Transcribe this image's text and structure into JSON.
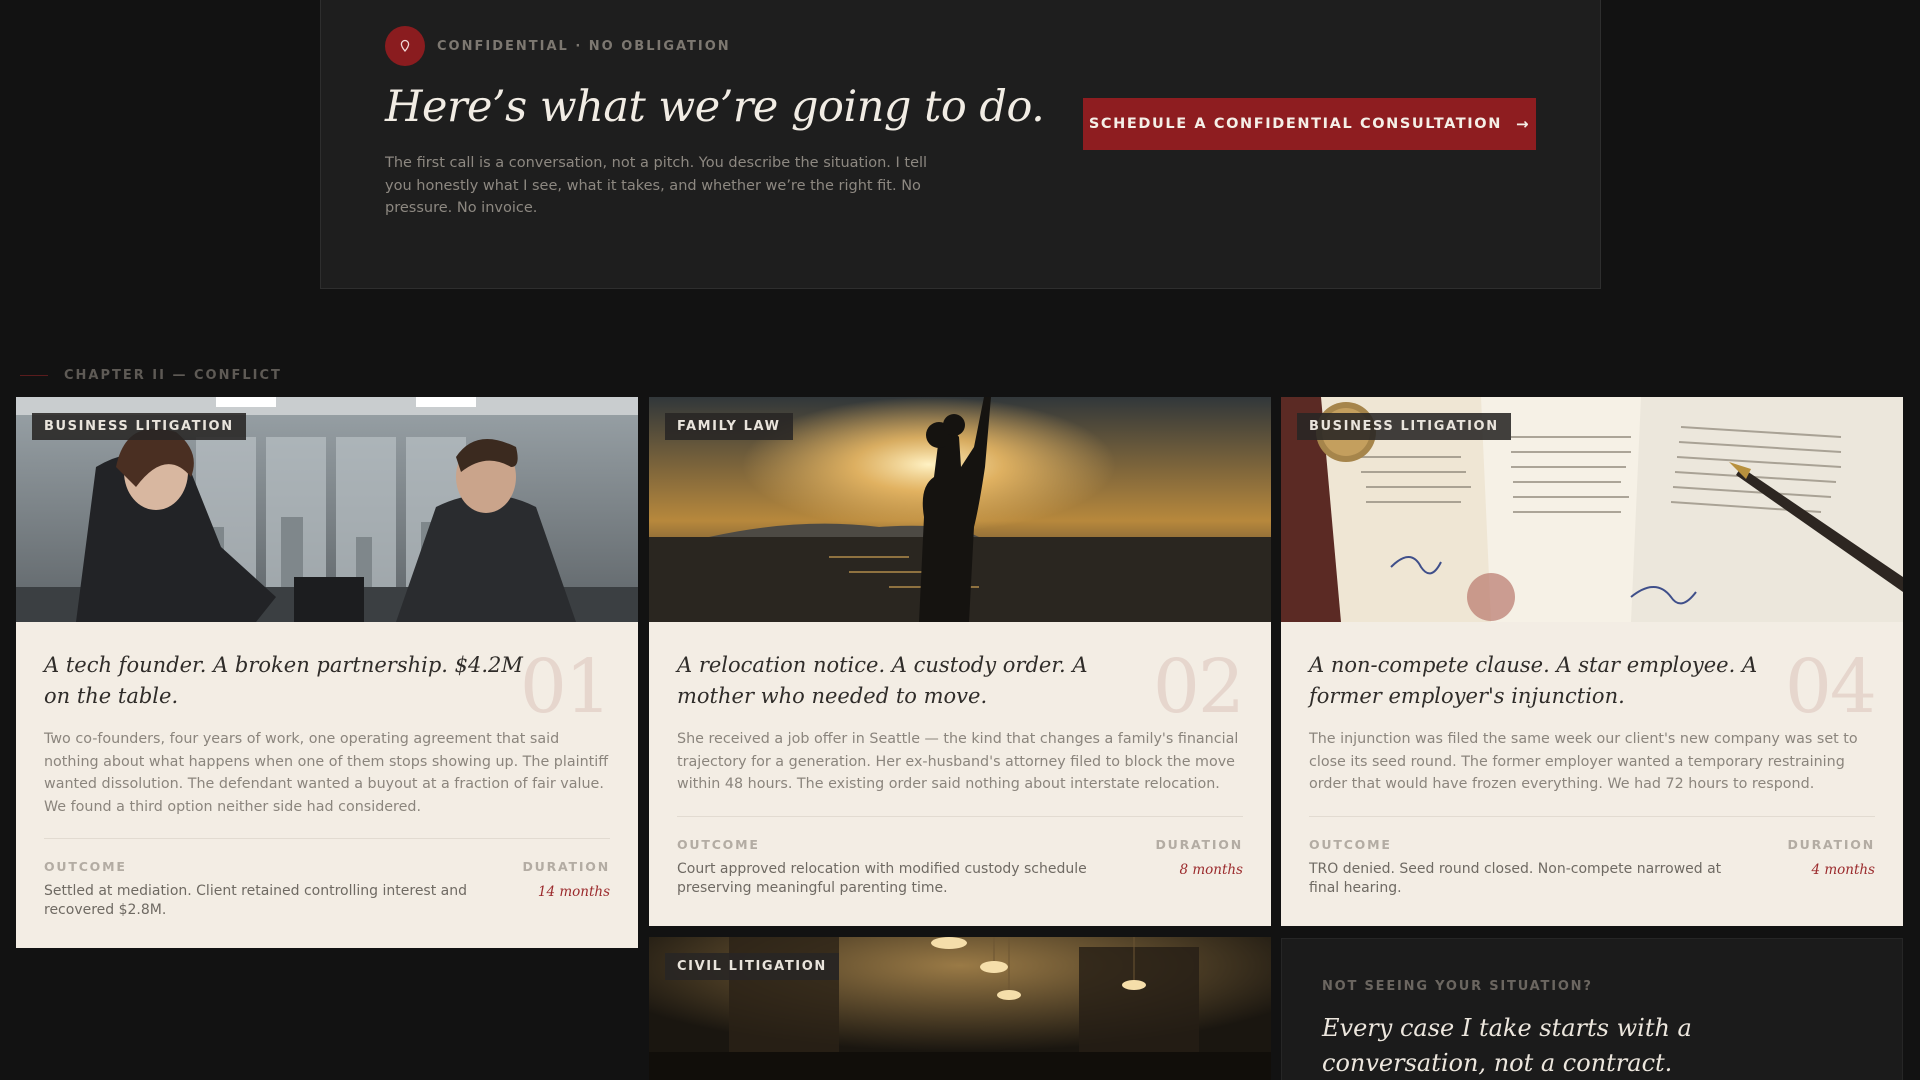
{
  "cta": {
    "badge_icon": "location-pin-icon",
    "badge_label": "CONFIDENTIAL · NO OBLIGATION",
    "heading": "Here’s what we’re going to do.",
    "body": "The first call is a conversation, not a pitch. You describe the situation. I tell you honestly what I see, what it takes, and whether we’re the right fit. No pressure. No invoice.",
    "button_label": "SCHEDULE A CONFIDENTIAL CONSULTATION",
    "button_arrow": "→",
    "accent_color": "#8e1d20"
  },
  "chapter": {
    "label": "CHAPTER II — CONFLICT"
  },
  "cases": [
    {
      "tag": "BUSINESS LITIGATION",
      "number": "01",
      "title": "A tech founder. A broken partnership. $4.2M on the table.",
      "description": "Two co-founders, four years of work, one operating agreement that said nothing about what happens when one of them stops showing up. The plaintiff wanted dissolution. The defendant wanted a buyout at a fraction of fair value. We found a third option neither side had considered.",
      "outcome_label": "OUTCOME",
      "outcome": "Settled at mediation. Client retained controlling interest and recovered $2.8M.",
      "duration_label": "DURATION",
      "duration": "14 months"
    },
    {
      "tag": "FAMILY LAW",
      "number": "02",
      "title": "A relocation notice. A custody order. A mother who needed to move.",
      "description": "She received a job offer in Seattle — the kind that changes a family's financial trajectory for a generation. Her ex-husband's attorney filed to block the move within 48 hours. The existing order said nothing about interstate relocation.",
      "outcome_label": "OUTCOME",
      "outcome": "Court approved relocation with modified custody schedule preserving meaningful parenting time.",
      "duration_label": "DURATION",
      "duration": "8 months"
    },
    {
      "tag": "BUSINESS LITIGATION",
      "number": "04",
      "title": "A non-compete clause. A star employee. A former employer's injunction.",
      "description": "The injunction was filed the same week our client's new company was set to close its seed round. The former employer wanted a temporary restraining order that would have frozen everything. We had 72 hours to respond.",
      "outcome_label": "OUTCOME",
      "outcome": "TRO denied. Seed round closed. Non-compete narrowed at final hearing.",
      "duration_label": "DURATION",
      "duration": "4 months"
    },
    {
      "tag": "CIVIL LITIGATION"
    }
  ],
  "not_seeing": {
    "label": "NOT SEEING YOUR SITUATION?",
    "heading": "Every case I take starts with a conversation, not a contract."
  }
}
